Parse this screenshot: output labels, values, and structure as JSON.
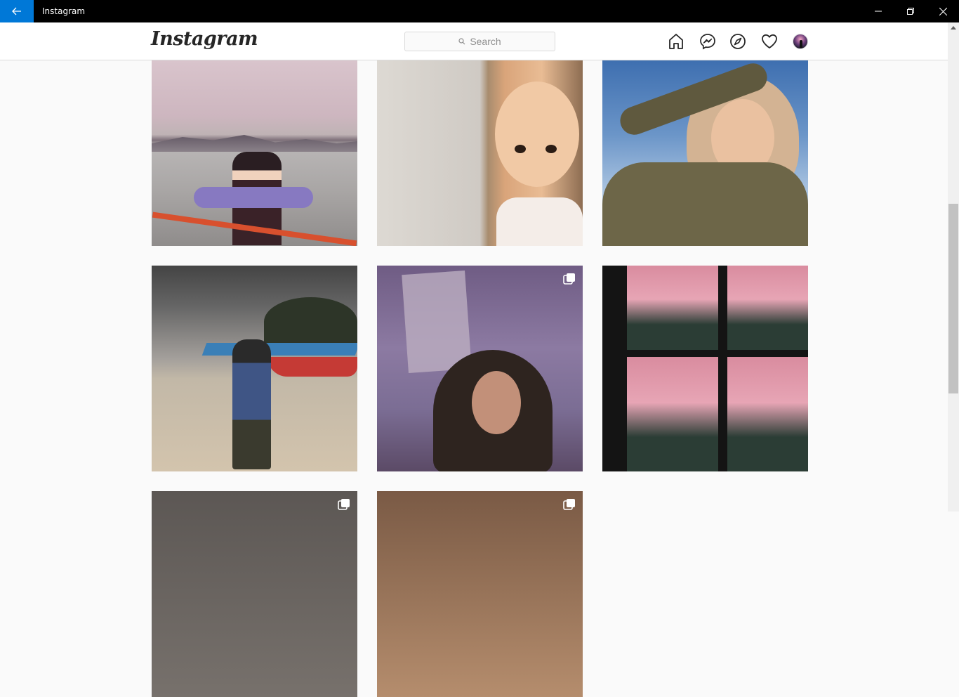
{
  "window": {
    "title": "Instagram",
    "controls": [
      "minimize",
      "restore",
      "close"
    ]
  },
  "nav": {
    "logo": "Instagram",
    "search_placeholder": "Search",
    "icons": [
      "home-icon",
      "messenger-icon",
      "explore-icon",
      "heart-icon",
      "profile-avatar"
    ]
  },
  "colors": {
    "accent": "#0078d7",
    "titlebar": "#000000",
    "background": "#fafafa",
    "border": "#dbdbdb"
  },
  "posts": [
    {
      "id": 1,
      "multiple": false
    },
    {
      "id": 2,
      "multiple": false
    },
    {
      "id": 3,
      "multiple": false
    },
    {
      "id": 4,
      "multiple": false
    },
    {
      "id": 5,
      "multiple": true
    },
    {
      "id": 6,
      "multiple": false
    },
    {
      "id": 7,
      "multiple": true
    },
    {
      "id": 8,
      "multiple": true
    }
  ]
}
